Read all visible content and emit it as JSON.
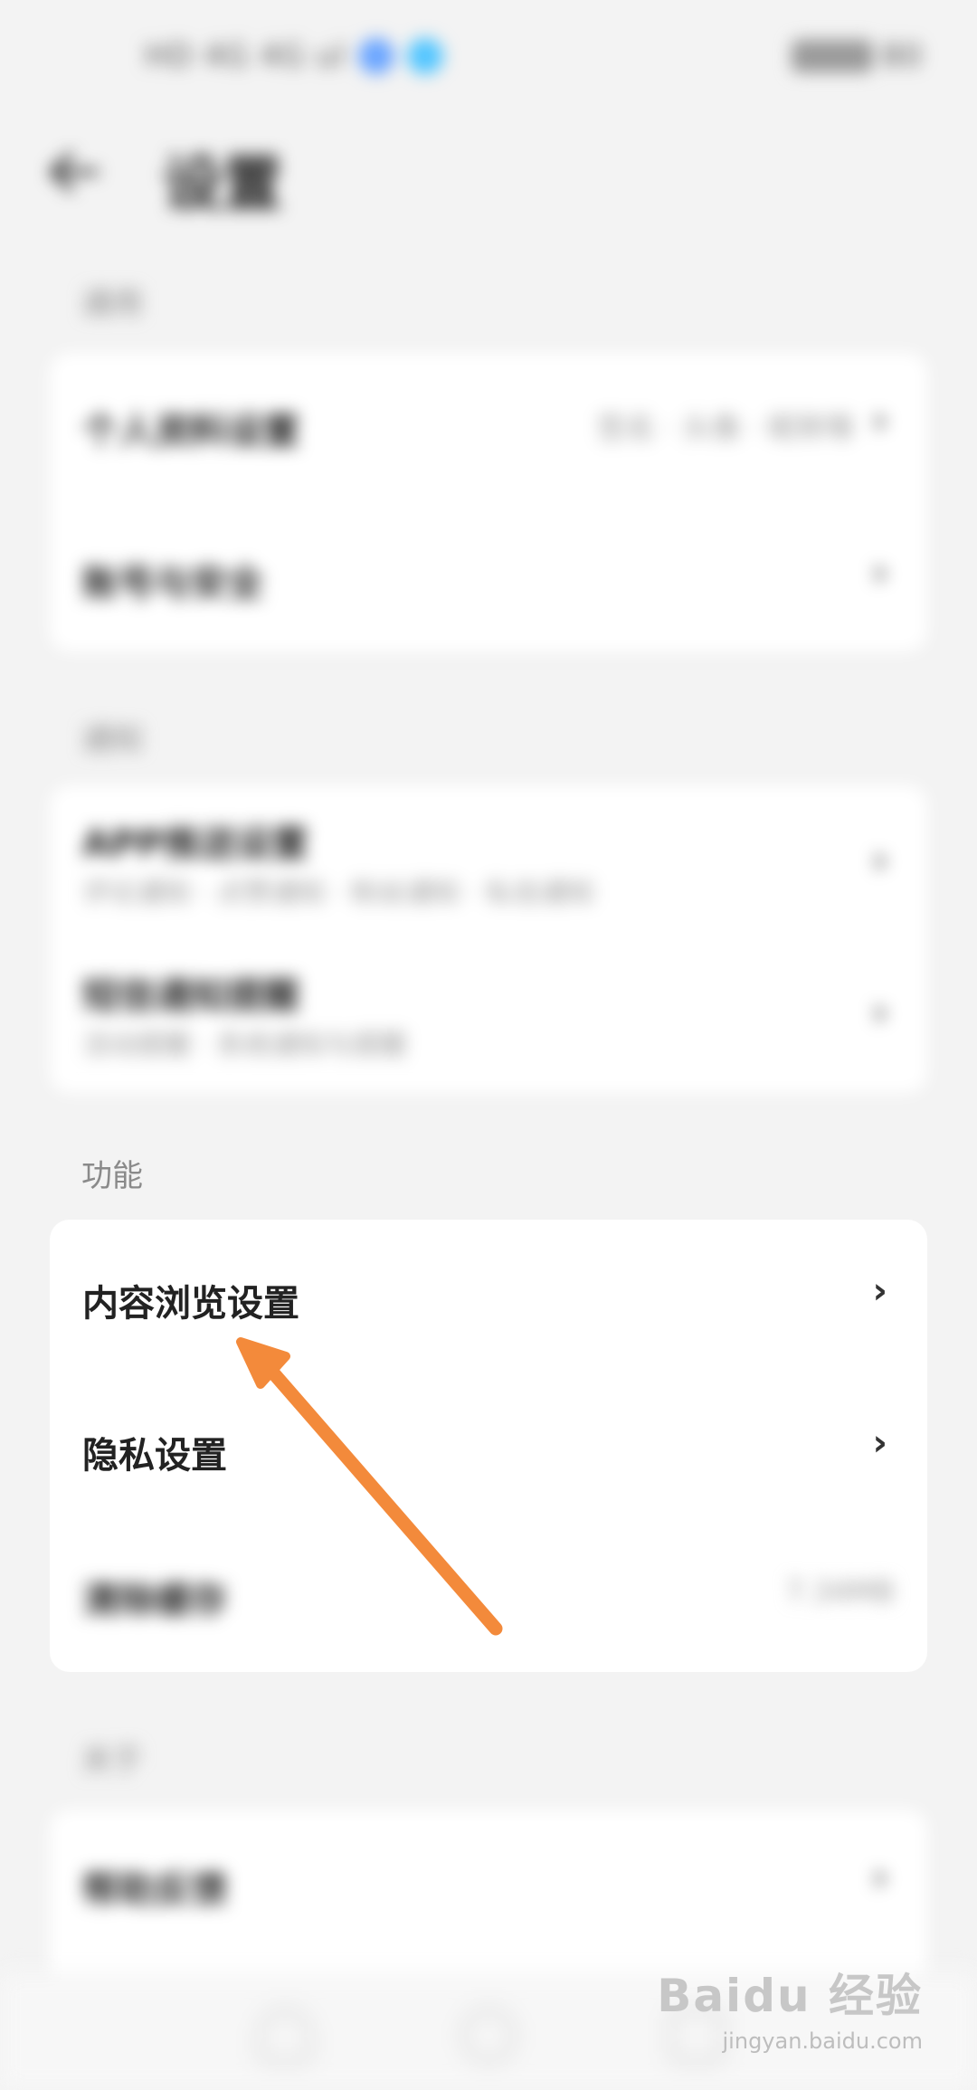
{
  "status_bar": {
    "left_text": "HD 4G 4G ul",
    "right_text": "80"
  },
  "header": {
    "title": "设置"
  },
  "section1": {
    "label": "通用",
    "rows": [
      {
        "title": "个人资料设置",
        "value": "签名 · 头像 · 昵称等"
      },
      {
        "title": "账号与安全"
      }
    ]
  },
  "section2": {
    "label": "通知",
    "rows": [
      {
        "title": "APP推送设置",
        "subtitle": "评论通知 · 点赞通知 · 粉丝通知 · 私信通知"
      },
      {
        "title": "短信通知提醒",
        "subtitle": "活动提醒 · 系统通知与提醒"
      }
    ]
  },
  "section3": {
    "label": "功能",
    "rows": [
      {
        "title": "内容浏览设置",
        "chevron": "›"
      },
      {
        "title": "隐私设置",
        "chevron": "›"
      },
      {
        "title": "清除缓存",
        "value": "7.34MB"
      }
    ]
  },
  "section4": {
    "label": "关于",
    "rows": [
      {
        "title": "帮助反馈"
      }
    ]
  },
  "watermark": {
    "main": "Baidu 经验",
    "sub": "jingyan.baidu.com"
  },
  "colors": {
    "arrow": "#f38a3b",
    "status_dot_1": "#6aa5ff",
    "status_dot_2": "#52c5ff"
  }
}
